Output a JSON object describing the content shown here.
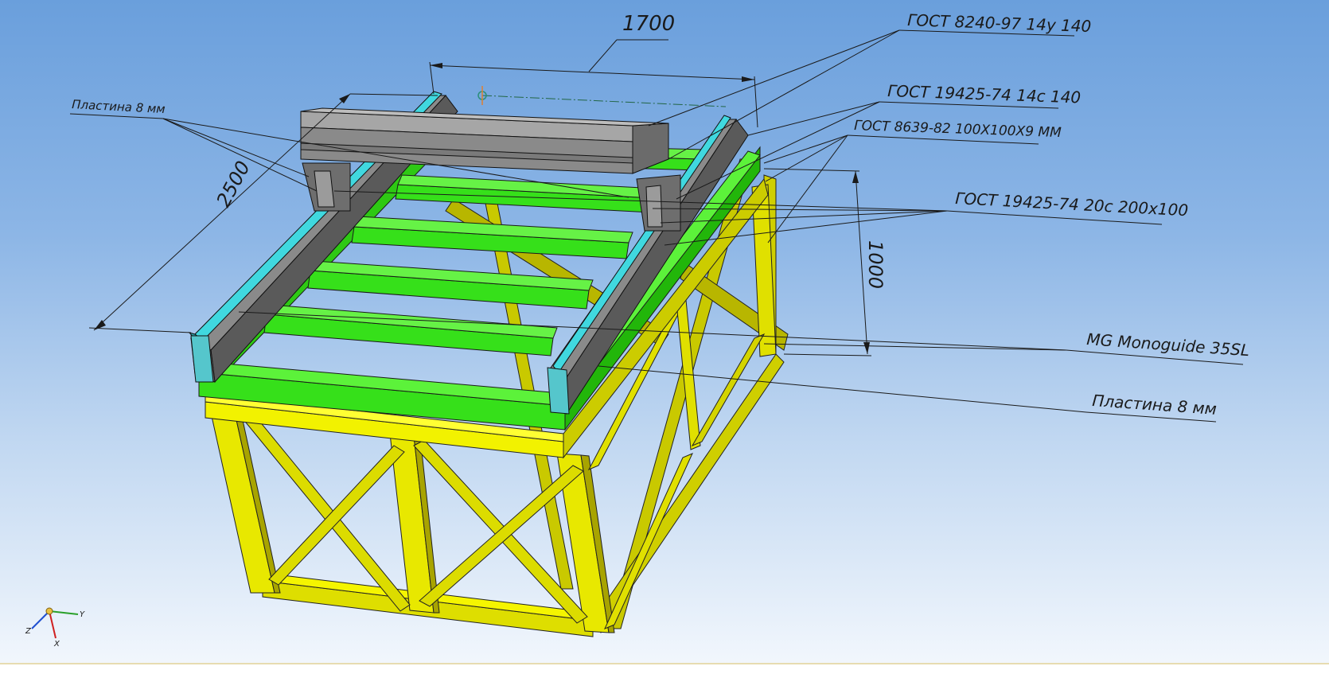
{
  "dimensions": {
    "width": "1700",
    "depth": "2500",
    "height": "1000"
  },
  "callouts": {
    "channel_14u": "ГОСТ 8240-97 14у 140",
    "ibeam_14s": "ГОСТ 19425-74 14с 140",
    "angle": "ГОСТ 8639-82 100X100X9 ММ",
    "ibeam_20s": "ГОСТ 19425-74 20с 200х100",
    "guide": "MG Monoguide 35SL",
    "plate_left": "Пластина 8 мм",
    "plate_right": "Пластина 8 мм"
  },
  "triad": {
    "x": "X",
    "y": "Y",
    "z": "Z"
  },
  "colors": {
    "frame_yellow": "#e6e600",
    "frame_dark": "#9e9a00",
    "beam_green": "#33dd11",
    "beam_green_dark": "#1f9e06",
    "rail_grey": "#6e6e6e",
    "rail_cyan": "#40d8df",
    "gantry_grey": "#8c8c8c"
  }
}
